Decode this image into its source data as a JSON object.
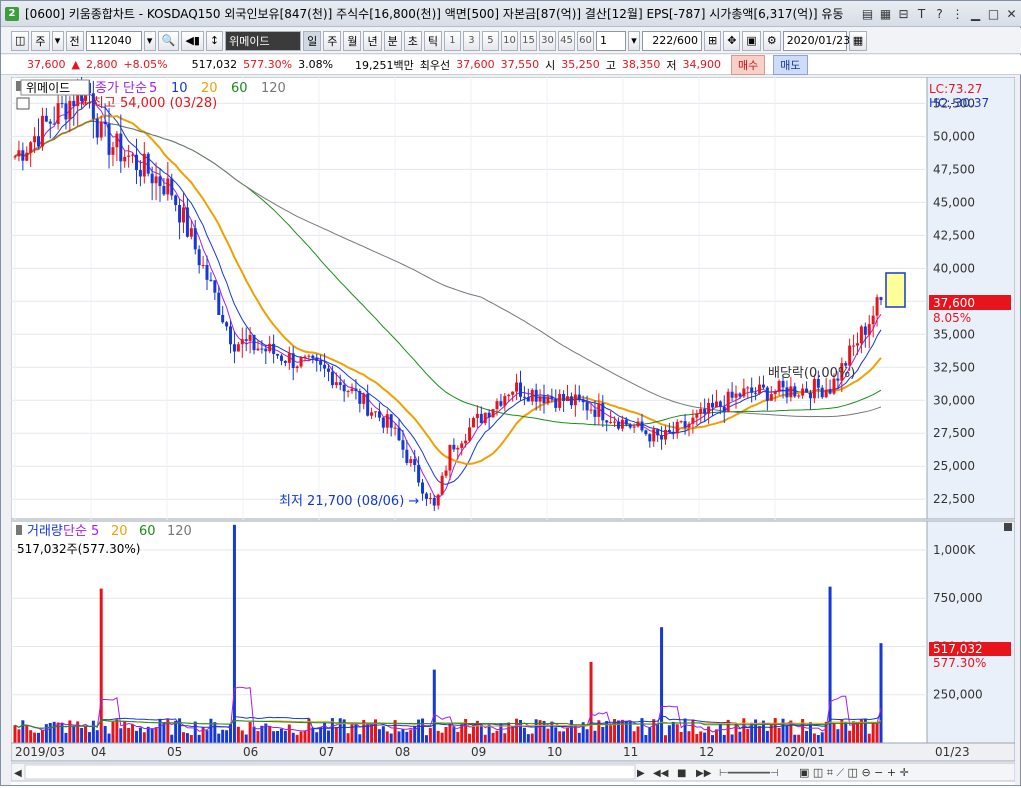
{
  "window": {
    "app_badge": "2",
    "title": "[0600] 키움종합차트 - KOSDAQ150 외국인보유[847(천)] 주식수[16,800(천)] 액면[500] 자본금[87(억)] 결산[12월] EPS[-787] 시가총액[6,317(억)] 유동"
  },
  "toolbar": {
    "period_unit": "주",
    "prev_label": "전",
    "code_value": "112040",
    "stock_name": "위메이드",
    "period_tabs": [
      "일",
      "주",
      "월",
      "년",
      "분",
      "초",
      "틱"
    ],
    "interval_options": [
      "1",
      "3",
      "5",
      "10",
      "15",
      "30",
      "45",
      "60"
    ],
    "count_select": "1",
    "range_value": "222",
    "range_total": "/600",
    "date_value": "2020/01/23"
  },
  "info": {
    "price": "37,600",
    "change_arrow": "▲",
    "change": "2,800",
    "change_pct": "+8.05%",
    "volume": "517,032",
    "volume_ratio": "577.30%",
    "turnover": "3.08%",
    "amount": "19,251백만",
    "best_label": "최우선",
    "best_ask": "37,600",
    "best_bid": "37,550",
    "open_label": "시",
    "open": "35,250",
    "high_label": "고",
    "high": "38,350",
    "low_label": "저",
    "low": "34,900",
    "buy_label": "매수",
    "sell_label": "매도"
  },
  "price_panel": {
    "stock_label": "위메이드",
    "legend": [
      {
        "text": "종가 단순",
        "color": "#a020f0"
      },
      {
        "text": "5",
        "color": "#a020f0"
      },
      {
        "text": "10",
        "color": "#1538d6"
      },
      {
        "text": "20",
        "color": "#f0a000"
      },
      {
        "text": "60",
        "color": "#1a8c1a"
      },
      {
        "text": "120",
        "color": "#777777"
      }
    ],
    "high_annotation": "최고 54,000 (03/28)",
    "low_annotation": "최저 21,700 (08/06)",
    "ex_div_annotation": "배당락(0.00%)",
    "lc_label": "LC:73.27",
    "hc_label": "HC:-30.37",
    "current_price_tag": "37,600",
    "current_pct_tag": "8.05%",
    "y_ticks": [
      "52,500",
      "50,000",
      "47,500",
      "45,000",
      "42,500",
      "40,000",
      "37,500",
      "35,000",
      "32,500",
      "30,000",
      "27,500",
      "25,000",
      "22,500"
    ]
  },
  "volume_panel": {
    "legend": [
      {
        "text": "거래량",
        "color": "#1538d6"
      },
      {
        "text": "단순",
        "color": "#a020f0"
      },
      {
        "text": "5",
        "color": "#a020f0"
      },
      {
        "text": "20",
        "color": "#f0a000"
      },
      {
        "text": "60",
        "color": "#1a8c1a"
      },
      {
        "text": "120",
        "color": "#777777"
      }
    ],
    "volume_readout": "517,032주(577.30%)",
    "y_ticks": [
      "1,000K",
      "750,000",
      "500,000",
      "250,000"
    ],
    "current_volume_tag": "517,032",
    "current_ratio_tag": "577.30%"
  },
  "x_axis": {
    "labels": [
      "2019/03",
      "04",
      "05",
      "06",
      "07",
      "08",
      "09",
      "10",
      "11",
      "12",
      "2020/01"
    ],
    "right_label": "01/23"
  },
  "chart_data": {
    "type": "candlestick",
    "x_range": [
      "2019/03",
      "2020/01/23"
    ],
    "price_ylim": [
      21000,
      54500
    ],
    "volume_ylim": [
      0,
      1150000
    ],
    "price_anchors": [
      {
        "date": "2019/03",
        "close": 48500
      },
      {
        "date": "2019/03/28",
        "high": 54000
      },
      {
        "date": "2019/04",
        "close": 50000
      },
      {
        "date": "2019/05",
        "close": 46000
      },
      {
        "date": "2019/05/20",
        "close": 34500
      },
      {
        "date": "2019/06",
        "close": 34000
      },
      {
        "date": "2019/07",
        "close": 32000
      },
      {
        "date": "2019/07/25",
        "close": 28000
      },
      {
        "date": "2019/08/06",
        "low": 21700
      },
      {
        "date": "2019/08",
        "close": 26500
      },
      {
        "date": "2019/09",
        "close": 31000
      },
      {
        "date": "2019/10",
        "close": 29500
      },
      {
        "date": "2019/11",
        "close": 27000
      },
      {
        "date": "2019/12",
        "close": 30500
      },
      {
        "date": "2020/01",
        "close": 31000
      },
      {
        "date": "2020/01/23",
        "close": 37600
      }
    ],
    "ma_lines": [
      {
        "name": "5",
        "color": "#a020f0"
      },
      {
        "name": "10",
        "color": "#1538d6"
      },
      {
        "name": "20",
        "color": "#f0a000"
      },
      {
        "name": "60",
        "color": "#1a8c1a"
      },
      {
        "name": "120",
        "color": "#777777"
      }
    ],
    "volume_spikes": [
      {
        "date": "2019/04",
        "volume": 800000
      },
      {
        "date": "2019/05/20",
        "volume": 1130000
      },
      {
        "date": "2019/08/06",
        "volume": 380000
      },
      {
        "date": "2019/10",
        "volume": 420000
      },
      {
        "date": "2019/11",
        "volume": 600000
      },
      {
        "date": "2020/01",
        "volume": 810000
      },
      {
        "date": "2020/01/23",
        "volume": 517032
      }
    ]
  }
}
